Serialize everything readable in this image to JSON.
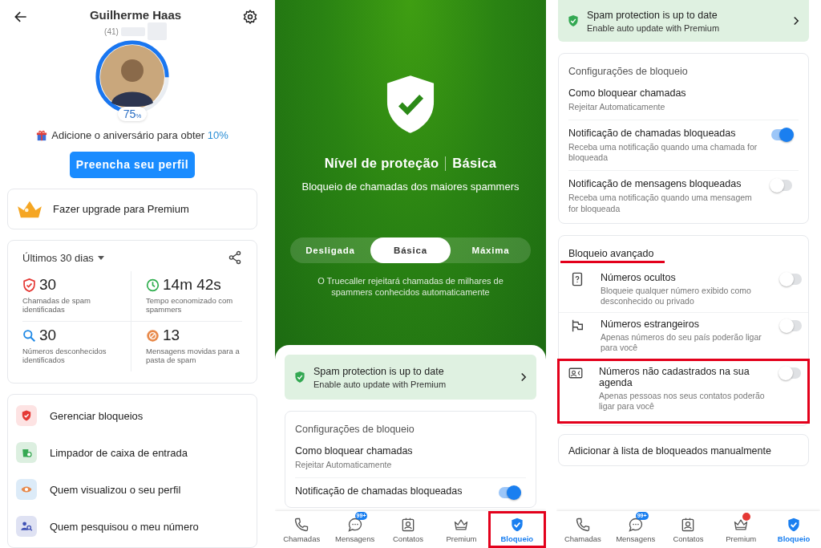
{
  "profile_screen": {
    "name": "Guilherme Haas",
    "phone_prefix": "(41)",
    "progress": {
      "level": 0.75,
      "value": "75",
      "unit": "%"
    },
    "birthday_prompt": {
      "text": "Adicione o aniversário para obter",
      "highlight": "10%"
    },
    "fill_button": "Preencha seu perfil",
    "premium_card": "Fazer upgrade para Premium",
    "stats": {
      "period": "Últimos 30 dias",
      "items": [
        {
          "kind": "spam",
          "value": "30",
          "label": "Chamadas de spam identificadas"
        },
        {
          "kind": "time",
          "value": "14m 42s",
          "label": "Tempo economizado com spammers"
        },
        {
          "kind": "unknown",
          "value": "30",
          "label": "Números desconhecidos identificados"
        },
        {
          "kind": "messages",
          "value": "13",
          "label": "Mensagens movidas para a pasta de spam"
        }
      ]
    },
    "menu": [
      {
        "kind": "block",
        "label": "Gerenciar bloqueios"
      },
      {
        "kind": "cleaner",
        "label": "Limpador de caixa de entrada"
      },
      {
        "kind": "viewers",
        "label": "Quem visualizou o seu perfil"
      },
      {
        "kind": "searchers",
        "label": "Quem pesquisou o meu número"
      }
    ]
  },
  "protection_screen": {
    "title": "Nível de proteção",
    "level_name": "Básica",
    "subtitle": "Bloqueio de chamadas dos maiores spammers",
    "modes": [
      {
        "label": "Desligada",
        "selected": false
      },
      {
        "label": "Básica",
        "selected": true
      },
      {
        "label": "Máxima",
        "selected": false
      }
    ],
    "description": "O Truecaller rejeitará chamadas de milhares de spammers conhecidos automaticamente",
    "banner": {
      "title": "Spam protection is up to date",
      "subtitle": "Enable auto update with Premium"
    },
    "settings": {
      "title": "Configurações de bloqueio",
      "rows": [
        {
          "kind": "value",
          "title": "Como bloquear chamadas",
          "value": "Rejeitar Automaticamente"
        },
        {
          "kind": "toggle",
          "title": "Notificação de chamadas bloqueadas",
          "on": true
        }
      ]
    },
    "nav": [
      {
        "kind": "calls",
        "label": "Chamadas",
        "selected": false,
        "dot": false,
        "outlined": false
      },
      {
        "kind": "messages",
        "label": "Mensagens",
        "selected": false,
        "badge": "99+",
        "dot": false,
        "outlined": false
      },
      {
        "kind": "contacts",
        "label": "Contatos",
        "selected": false,
        "dot": false,
        "outlined": false
      },
      {
        "kind": "premium",
        "label": "Premium",
        "selected": false,
        "dot": false,
        "outlined": false
      },
      {
        "kind": "block",
        "label": "Bloqueio",
        "selected": true,
        "dot": false,
        "outlined": true
      }
    ]
  },
  "settings_screen": {
    "banner": {
      "title": "Spam protection is up to date",
      "subtitle": "Enable auto update with Premium"
    },
    "settings": {
      "title": "Configurações de bloqueio",
      "rows": [
        {
          "kind": "value",
          "title": "Como bloquear chamadas",
          "value": "Rejeitar Automaticamente"
        },
        {
          "kind": "toggle",
          "title": "Notificação de chamadas bloqueadas",
          "description": "Receba uma notificação quando uma chamada for bloqueada",
          "on": true
        },
        {
          "kind": "toggle",
          "title": "Notificação de mensagens bloqueadas",
          "description": "Receba uma notificação quando uma mensagem for bloqueada",
          "on": false
        }
      ]
    },
    "advanced": {
      "title": "Bloqueio avançado",
      "underlined": true,
      "rows": [
        {
          "kind": "hidden",
          "title": "Números ocultos",
          "description": "Bloqueie qualquer número exibido como desconhecido ou privado",
          "on": false,
          "outlined": false
        },
        {
          "kind": "foreign",
          "title": "Números estrangeiros",
          "description": "Apenas números do seu país poderão ligar para você",
          "on": false,
          "outlined": false
        },
        {
          "kind": "unsaved",
          "title": "Números não cadastrados na sua agenda",
          "description": "Apenas pessoas nos seus contatos poderão ligar para você",
          "on": false,
          "outlined": true
        }
      ]
    },
    "manual": {
      "title": "Adicionar à lista de bloqueados manualmente"
    },
    "nav": [
      {
        "kind": "calls",
        "label": "Chamadas",
        "selected": false,
        "dot": false,
        "outlined": false
      },
      {
        "kind": "messages",
        "label": "Mensagens",
        "selected": false,
        "badge": "99+",
        "dot": false,
        "outlined": false
      },
      {
        "kind": "contacts",
        "label": "Contatos",
        "selected": false,
        "dot": false,
        "outlined": false
      },
      {
        "kind": "premium",
        "label": "Premium",
        "selected": false,
        "dot": true,
        "outlined": false
      },
      {
        "kind": "block",
        "label": "Bloqueio",
        "selected": true,
        "dot": false,
        "outlined": false
      }
    ]
  }
}
